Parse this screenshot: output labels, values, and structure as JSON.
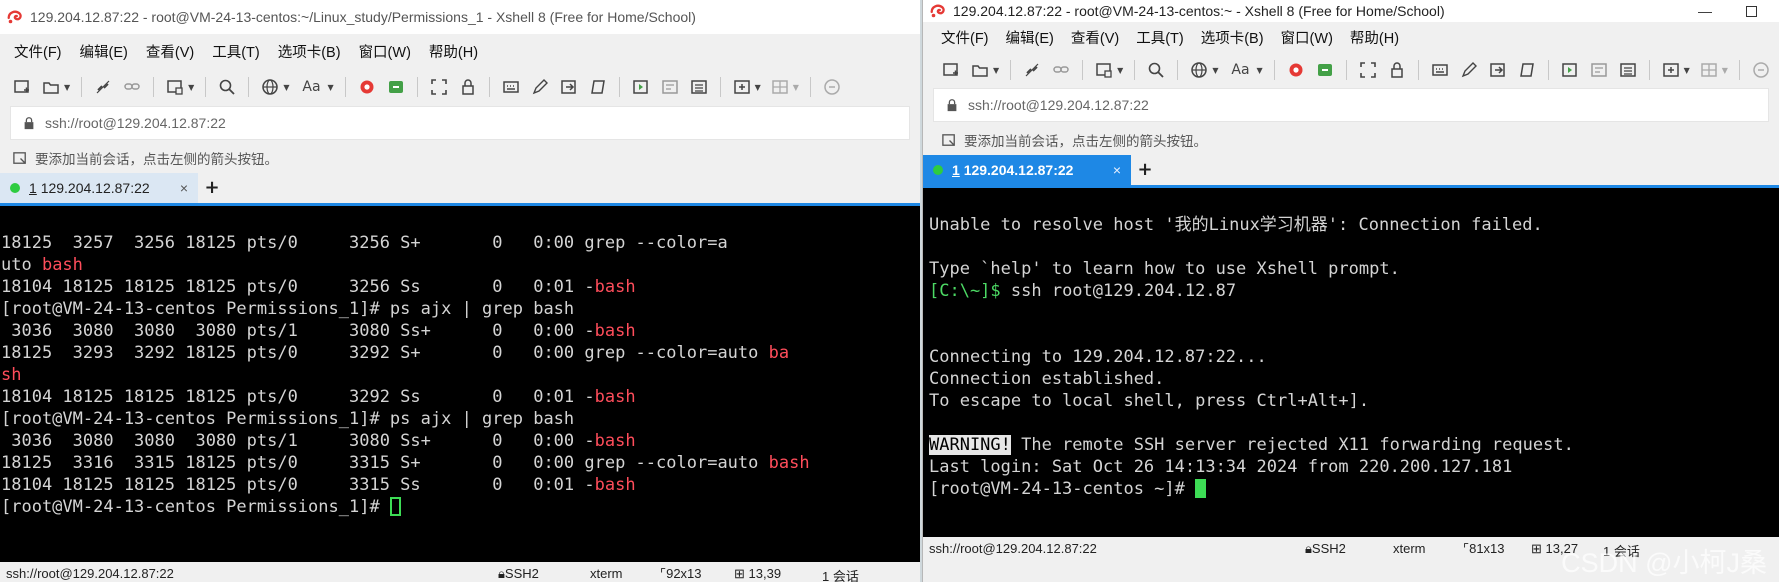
{
  "left": {
    "title": "129.204.12.87:22 - root@VM-24-13-centos:~/Linux_study/Permissions_1 - Xshell 8 (Free for Home/School)",
    "menu": [
      "文件(F)",
      "编辑(E)",
      "查看(V)",
      "工具(T)",
      "选项卡(B)",
      "窗口(W)",
      "帮助(H)"
    ],
    "address": "ssh://root@129.204.12.87:22",
    "hint": "要添加当前会话，点击左侧的箭头按钮。",
    "tab": {
      "num": "1",
      "label": "129.204.12.87:22",
      "close": "×",
      "add": "+"
    },
    "lines": [
      "18125  3257  3256 18125 pts/0     3256 S+       0   0:00 grep --color=a",
      "uto ",
      "18104 18125 18125 18125 pts/0     3256 Ss       0   0:01 -",
      "[root@VM-24-13-centos Permissions_1]# ps ajx | grep bash",
      " 3036  3080  3080  3080 pts/1     3080 Ss+      0   0:00 -",
      "18125  3293  3292 18125 pts/0     3292 S+       0   0:00 grep --color=auto ",
      "",
      "18104 18125 18125 18125 pts/0     3292 Ss       0   0:01 -",
      "[root@VM-24-13-centos Permissions_1]# ps ajx | grep bash",
      " 3036  3080  3080  3080 pts/1     3080 Ss+      0   0:00 -",
      "18125  3316  3315 18125 pts/0     3315 S+       0   0:00 grep --color=auto ",
      "18104 18125 18125 18125 pts/0     3315 Ss       0   0:01 -",
      "[root@VM-24-13-centos Permissions_1]# "
    ],
    "red": [
      "",
      "bash",
      "bash",
      "",
      "bash",
      "ba",
      "sh",
      "bash",
      "",
      "bash",
      "bash",
      "bash",
      ""
    ],
    "status": {
      "conn": "ssh://root@129.204.12.87:22",
      "proto": "SSH2",
      "term": "xterm",
      "size": "92x13",
      "pos": "13,39",
      "sessions": "1 会话"
    }
  },
  "right": {
    "title": "129.204.12.87:22 - root@VM-24-13-centos:~ - Xshell 8 (Free for Home/School)",
    "menu": [
      "文件(F)",
      "编辑(E)",
      "查看(V)",
      "工具(T)",
      "选项卡(B)",
      "窗口(W)",
      "帮助(H)"
    ],
    "address": "ssh://root@129.204.12.87:22",
    "hint": "要添加当前会话，点击左侧的箭头按钮。",
    "tab": {
      "num": "1",
      "label": "129.204.12.87:22",
      "close": "×",
      "add": "+"
    },
    "lines": {
      "l1": "Unable to resolve host '我的Linux学习机器': Connection failed.",
      "l2": "Type `help' to learn how to use Xshell prompt.",
      "l3_prompt": "[C:\\~]$",
      "l3_cmd": " ssh root@129.204.12.87",
      "l4": "Connecting to 129.204.12.87:22...",
      "l5": "Connection established.",
      "l6": "To escape to local shell, press Ctrl+Alt+].",
      "l7_warn": "WARNING!",
      "l7_rest": " The remote SSH server rejected X11 forwarding request.",
      "l8": "Last login: Sat Oct 26 14:13:34 2024 from 220.200.127.181",
      "l9": "[root@VM-24-13-centos ~]# "
    },
    "status": {
      "conn": "ssh://root@129.204.12.87:22",
      "proto": "SSH2",
      "term": "xterm",
      "size": "81x13",
      "pos": "13,27",
      "sessions": "1 会话"
    }
  },
  "watermark": "CSDN @小柯J桑",
  "colors": {
    "accent": "#1e88e5",
    "terminal_bg": "#000000",
    "terminal_red": "#ff4d5b",
    "terminal_green": "#4cd964",
    "status_dot": "#2ecc40"
  },
  "icons": [
    "new-session-icon",
    "open-folder-icon",
    "disconnect-icon",
    "link-icon",
    "new-window-icon",
    "search-icon",
    "globe-icon",
    "font-icon",
    "xshell-logo-icon",
    "xftp-icon",
    "fullscreen-icon",
    "lock-icon",
    "keyboard-icon",
    "pen-icon",
    "compose-icon",
    "script-icon",
    "split-icon",
    "layout-icon",
    "chat-icon"
  ]
}
